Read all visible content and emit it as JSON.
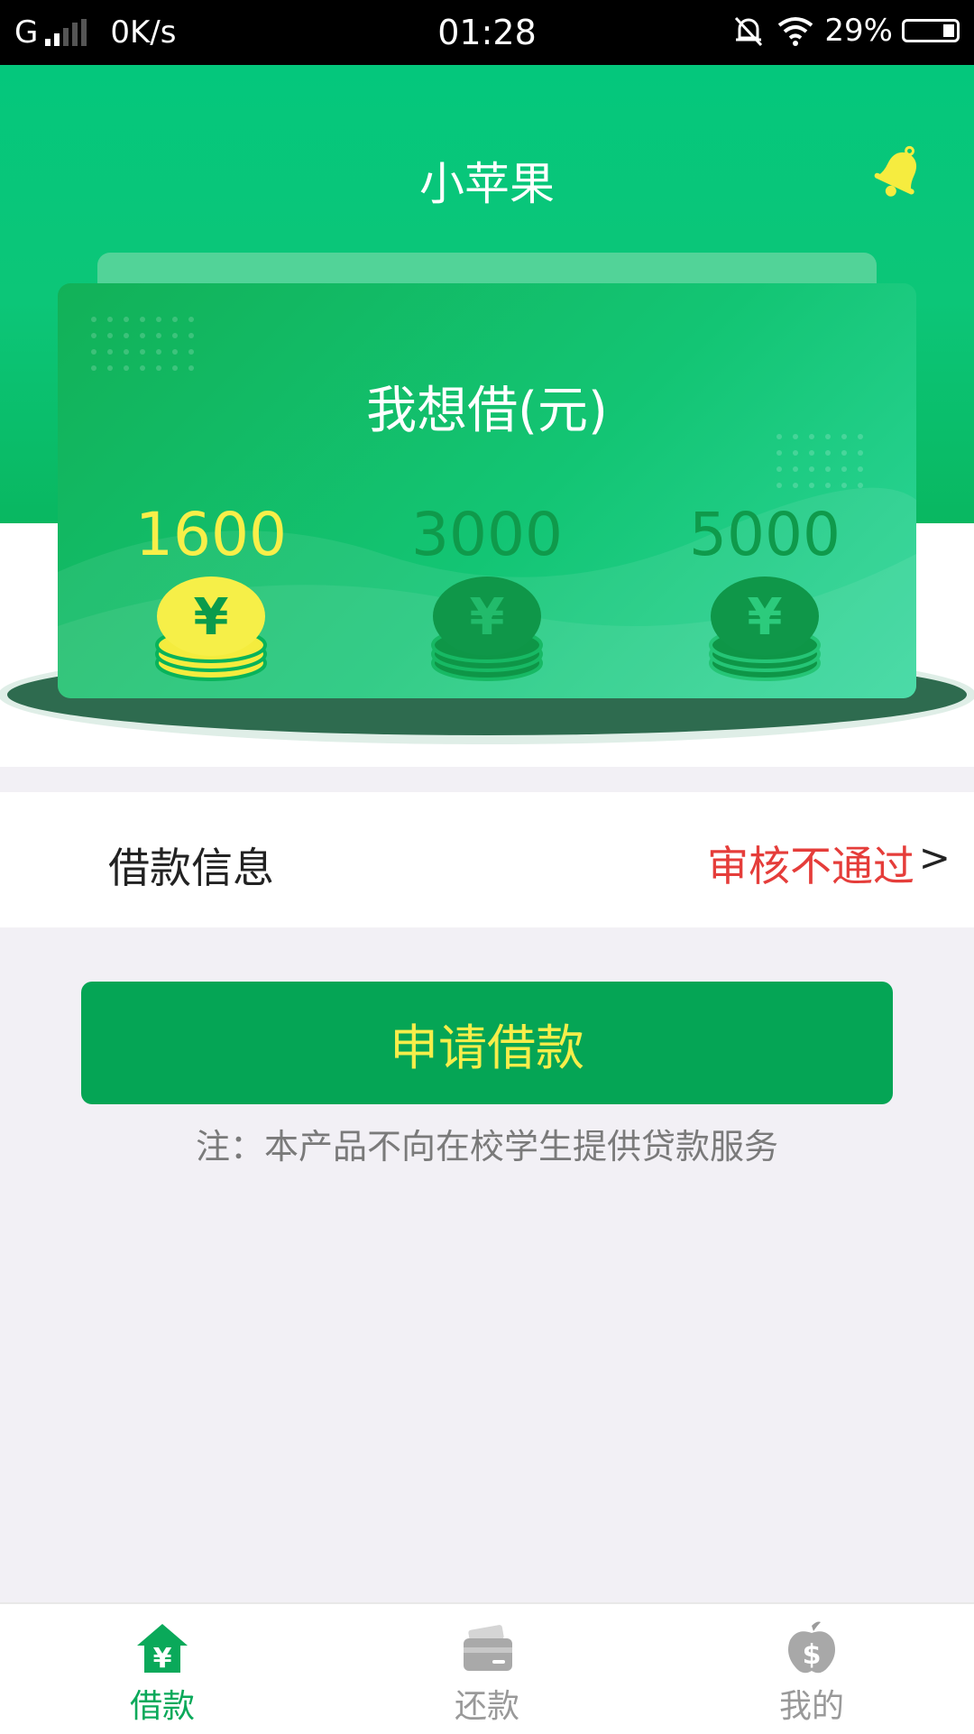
{
  "status_bar": {
    "network": "G",
    "speed": "0K/s",
    "time": "01:28",
    "battery": "29%"
  },
  "header": {
    "title": "小苹果"
  },
  "card": {
    "title": "我想借(元)",
    "amounts": [
      {
        "value": "1600",
        "selected": true
      },
      {
        "value": "3000",
        "selected": false
      },
      {
        "value": "5000",
        "selected": false
      }
    ]
  },
  "loan_info": {
    "label": "借款信息",
    "status": "审核不通过",
    "arrow": ">"
  },
  "apply_button": {
    "label": "申请借款"
  },
  "note": "注：本产品不向在校学生提供贷款服务",
  "tabs": [
    {
      "label": "借款",
      "icon": "home-yen-icon",
      "active": true
    },
    {
      "label": "还款",
      "icon": "wallet-icon",
      "active": false
    },
    {
      "label": "我的",
      "icon": "apple-dollar-icon",
      "active": false
    }
  ],
  "colors": {
    "brand_green": "#05a555",
    "accent_yellow": "#f8ef49",
    "status_red": "#e53d3a"
  }
}
